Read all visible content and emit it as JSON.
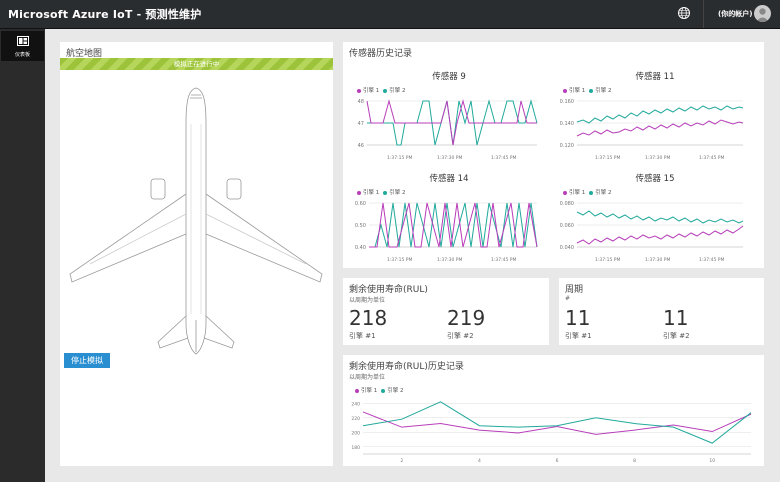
{
  "header": {
    "title": "Microsoft Azure IoT - 预测性维护",
    "account": "(你的帐户)"
  },
  "nav": {
    "dashboard_label": "仪表板"
  },
  "flight_map": {
    "title": "航空地图",
    "banner": "模拟正在进行中",
    "stop_button": "停止模拟"
  },
  "sensor_history": {
    "title": "传感器历史记录",
    "legend": [
      "引擎 1",
      "引擎 2"
    ],
    "charts": [
      {
        "title": "传感器 9",
        "yticks": [
          "48",
          "47",
          "46"
        ],
        "xticks": [
          "1:37:15 PM",
          "1:37:30 PM",
          "1:37:45 PM"
        ]
      },
      {
        "title": "传感器 11",
        "yticks": [
          "0.160",
          "0.140",
          "0.120"
        ],
        "xticks": [
          "1:37:15 PM",
          "1:37:30 PM",
          "1:37:45 PM"
        ]
      },
      {
        "title": "传感器 14",
        "yticks": [
          "0.60",
          "0.50",
          "0.40"
        ],
        "xticks": [
          "1:37:15 PM",
          "1:37:30 PM",
          "1:37:45 PM"
        ]
      },
      {
        "title": "传感器 15",
        "yticks": [
          "0.080",
          "0.060",
          "0.040"
        ],
        "xticks": [
          "1:37:15 PM",
          "1:37:30 PM",
          "1:37:45 PM"
        ]
      }
    ]
  },
  "rul": {
    "title": "剩余使用寿命(RUL)",
    "subtitle": "以周期为单位",
    "engine1_value": "218",
    "engine1_label": "引擎 #1",
    "engine2_value": "219",
    "engine2_label": "引擎 #2"
  },
  "cycles": {
    "title": "周期",
    "subtitle": "#",
    "engine1_value": "11",
    "engine1_label": "引擎 #1",
    "engine2_value": "11",
    "engine2_label": "引擎 #2"
  },
  "rul_history": {
    "title": "剩余使用寿命(RUL)历史记录",
    "subtitle": "以周期为单位",
    "legend": [
      "引擎 1",
      "引擎 2"
    ]
  },
  "colors": {
    "engine1": "#b83dba",
    "engine2": "#21a99c",
    "accent": "#2a8fd1"
  },
  "chart_data": [
    {
      "type": "line",
      "title": "剩余使用寿命(RUL)历史记录",
      "x": [
        1,
        2,
        3,
        4,
        5,
        6,
        7,
        8,
        9,
        10,
        11
      ],
      "xticks": [
        2,
        4,
        6,
        8,
        10
      ],
      "ylim": [
        170,
        250
      ],
      "yticks": [
        240,
        220,
        200,
        180
      ],
      "series": [
        {
          "name": "引擎 1",
          "values": [
            228,
            207,
            212,
            203,
            199,
            208,
            197,
            203,
            210,
            201,
            225
          ]
        },
        {
          "name": "引擎 2",
          "values": [
            209,
            218,
            242,
            209,
            207,
            209,
            220,
            212,
            207,
            185,
            227
          ]
        }
      ]
    }
  ]
}
